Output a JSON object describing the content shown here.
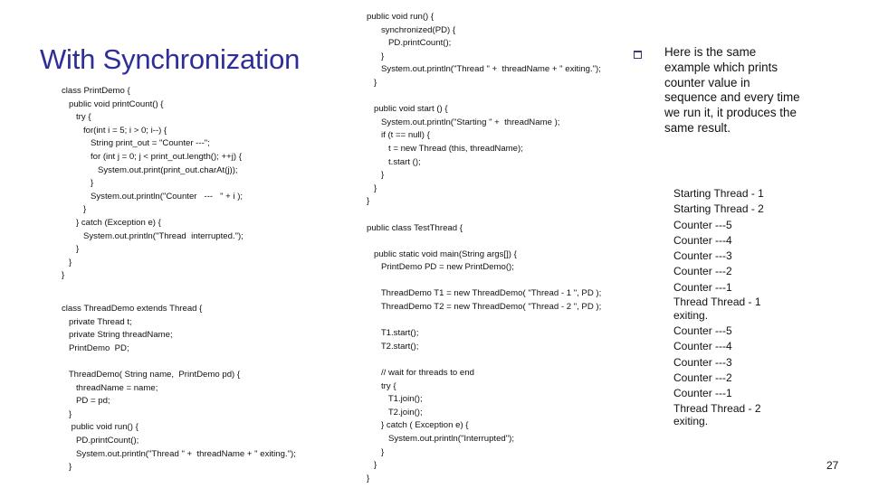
{
  "slide": {
    "title": "With Synchronization",
    "page_number": "27",
    "accent_color": "#2e2e99"
  },
  "code_left_a": [
    "class PrintDemo {",
    "   public void printCount() {",
    "      try {",
    "         for(int i = 5; i > 0; i--) {",
    "            String print_out = \"Counter ---\";",
    "            for (int j = 0; j < print_out.length(); ++j) {",
    "               System.out.print(print_out.charAt(j));",
    "            }",
    "            System.out.println(\"Counter   ---   \" + i );",
    "         }",
    "      } catch (Exception e) {",
    "         System.out.println(\"Thread  interrupted.\");",
    "      }",
    "   }",
    "}"
  ],
  "code_left_b": [
    "class ThreadDemo extends Thread {",
    "   private Thread t;",
    "   private String threadName;",
    "   PrintDemo  PD;",
    "",
    "   ThreadDemo( String name,  PrintDemo pd) {",
    "      threadName = name;",
    "      PD = pd;",
    "   }",
    "    public void run() {",
    "      PD.printCount();",
    "      System.out.println(\"Thread \" +  threadName + \" exiting.\");",
    "   }"
  ],
  "code_right": [
    "public void run() {",
    "      synchronized(PD) {",
    "         PD.printCount();",
    "      }",
    "      System.out.println(\"Thread \" +  threadName + \" exiting.\");",
    "   }",
    "",
    "   public void start () {",
    "      System.out.println(\"Starting \" +  threadName );",
    "      if (t == null) {",
    "         t = new Thread (this, threadName);",
    "         t.start ();",
    "      }",
    "   }",
    "}",
    "",
    "public class TestThread {",
    "",
    "   public static void main(String args[]) {",
    "      PrintDemo PD = new PrintDemo();",
    "",
    "      ThreadDemo T1 = new ThreadDemo( \"Thread - 1 \", PD );",
    "      ThreadDemo T2 = new ThreadDemo( \"Thread - 2 \", PD );",
    "",
    "      T1.start();",
    "      T2.start();",
    "",
    "      // wait for threads to end",
    "      try {",
    "         T1.join();",
    "         T2.join();",
    "      } catch ( Exception e) {",
    "         System.out.println(\"Interrupted\");",
    "      }",
    "   }",
    "}"
  ],
  "bullet": {
    "icon": "hollow-square-bullet",
    "text": "Here is the same example which prints counter value in sequence and every time we run it, it produces the same result."
  },
  "output_lines": [
    "Starting Thread - 1",
    "Starting Thread - 2",
    "Counter ---5",
    "Counter ---4",
    "Counter ---3",
    "Counter ---2",
    "Counter ---1",
    "Thread Thread - 1 exiting.",
    "Counter ---5",
    "Counter ---4",
    "Counter ---3",
    "Counter ---2",
    "Counter ---1",
    "Thread Thread - 2 exiting."
  ]
}
